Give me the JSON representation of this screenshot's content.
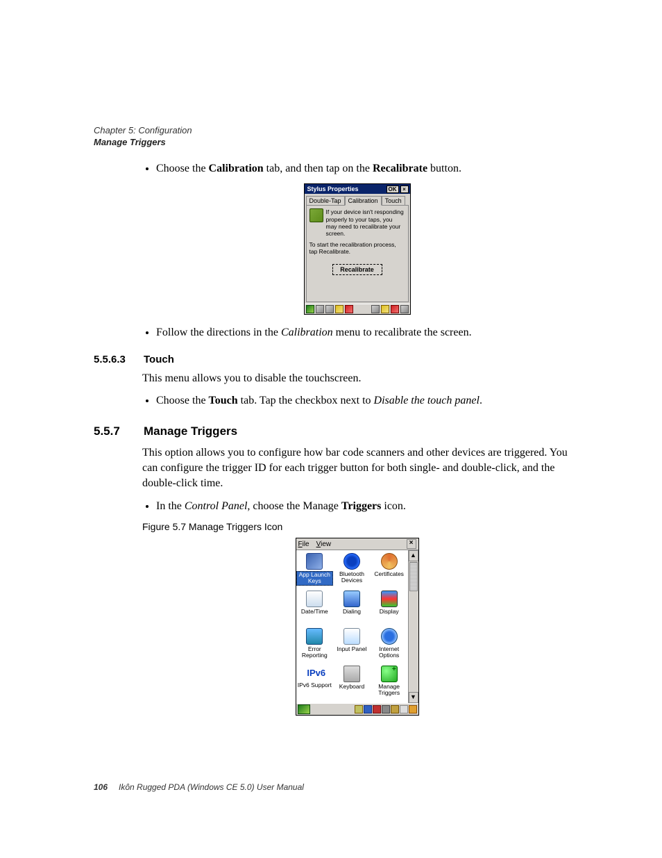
{
  "header": {
    "chapter": "Chapter 5: Configuration",
    "section": "Manage Triggers"
  },
  "body": {
    "bullet1_pre": "Choose the ",
    "bullet1_b1": "Calibration",
    "bullet1_mid": " tab, and then tap on the ",
    "bullet1_b2": "Recalibrate",
    "bullet1_post": " button.",
    "bullet2_pre": "Follow the directions in the ",
    "bullet2_i": "Calibration",
    "bullet2_post": " menu to recalibrate the screen.",
    "h563_num": "5.5.6.3",
    "h563_title": "Touch",
    "touch_para": "This menu allows you to disable the touchscreen.",
    "bullet3_pre": "Choose the ",
    "bullet3_b": "Touch",
    "bullet3_mid": " tab. Tap the checkbox next to ",
    "bullet3_i": "Disable the touch panel",
    "bullet3_post": ".",
    "h557_num": "5.5.7",
    "h557_title": "Manage Triggers",
    "mt_para": "This option allows you to configure how bar code scanners and other devices are triggered. You can configure the trigger ID for each trigger button for both single- and double-click, and the double-click time.",
    "bullet4_pre": "In the ",
    "bullet4_i": "Control Panel",
    "bullet4_mid": ", choose the Manage ",
    "bullet4_b": "Triggers",
    "bullet4_post": " icon.",
    "fig_caption": "Figure 5.7  Manage Triggers Icon"
  },
  "shot1": {
    "title": "Stylus Properties",
    "ok": "OK",
    "x": "×",
    "tabs": {
      "t1": "Double-Tap",
      "t2": "Calibration",
      "t3": "Touch"
    },
    "msg1": "If your device isn't responding properly to your taps, you may need to recalibrate your screen.",
    "msg2": "To start the recalibration process, tap Recalibrate.",
    "recal": "Recalibrate"
  },
  "shot2": {
    "menu_file": "File",
    "menu_view": "View",
    "x": "×",
    "up": "▲",
    "down": "▼",
    "items": [
      {
        "label": "App Launch Keys"
      },
      {
        "label": "Bluetooth Devices"
      },
      {
        "label": "Certificates"
      },
      {
        "label": "Date/Time"
      },
      {
        "label": "Dialing"
      },
      {
        "label": "Display"
      },
      {
        "label": "Error Reporting"
      },
      {
        "label": "Input Panel"
      },
      {
        "label": "Internet Options"
      },
      {
        "label": "IPv6 Support"
      },
      {
        "label": "Keyboard"
      },
      {
        "label": "Manage Triggers"
      }
    ],
    "ipv6": "IPv6"
  },
  "footer": {
    "page_num": "106",
    "text": "Ikôn Rugged PDA (Windows CE 5.0) User Manual"
  }
}
